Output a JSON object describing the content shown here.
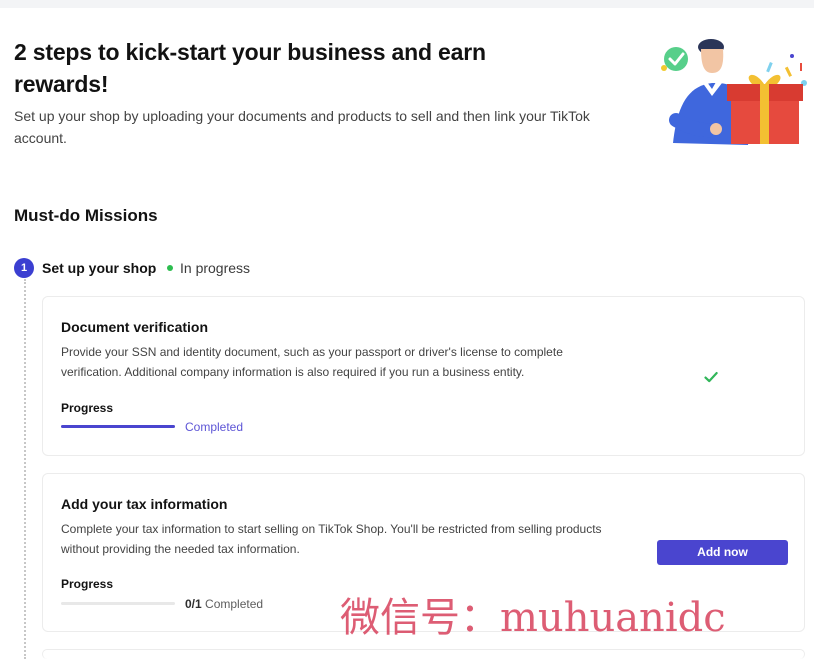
{
  "hero": {
    "title": "2 steps to kick-start your business and earn rewards!",
    "subtitle": "Set up your shop by uploading your documents and products to sell and then link your TikTok account."
  },
  "missions": {
    "title": "Must-do Missions",
    "step": {
      "number": "1",
      "title": "Set up your shop",
      "status": "In progress"
    },
    "cards": [
      {
        "title": "Document verification",
        "description": "Provide your SSN and identity document, such as your passport or driver's license to complete verification. Additional company information is also required if you run a business entity.",
        "progress_label": "Progress",
        "progress_status": "Completed",
        "progress_fraction": 1
      },
      {
        "title": "Add your tax information",
        "description": "Complete your tax information to start selling on TikTok Shop. You'll be restricted from selling products without providing the needed tax information.",
        "progress_label": "Progress",
        "progress_count": "0/1",
        "progress_status": "Completed",
        "progress_fraction": 0,
        "button_label": "Add now"
      }
    ]
  },
  "watermark": "微信号：muhuanidc",
  "icons": {
    "check": "check-icon",
    "illustration": "gift-celebration-illustration"
  },
  "colors": {
    "accent": "#4A45CF",
    "status_green": "#2DBD4F",
    "check_green": "#32B65A",
    "watermark": "#D63956"
  }
}
